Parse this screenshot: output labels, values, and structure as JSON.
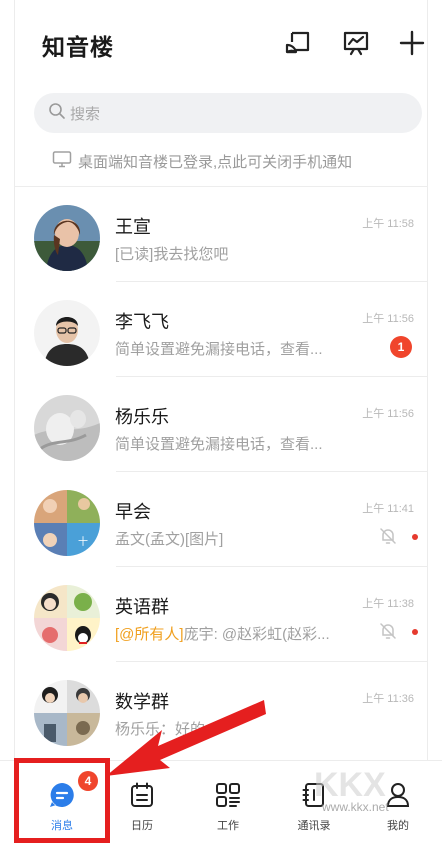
{
  "header": {
    "title": "知音楼",
    "icons": [
      "cast-icon",
      "presentation-icon",
      "plus-icon"
    ]
  },
  "search": {
    "placeholder": "搜索"
  },
  "notice": {
    "text": "桌面端知音楼已登录,点此可关闭手机通知"
  },
  "conversations": [
    {
      "name": "王宣",
      "preview": "[已读]我去找您吧",
      "time": "上午 11:58"
    },
    {
      "name": "李飞飞",
      "preview": "简单设置避免漏接电话，查看...",
      "time": "上午 11:56",
      "unread": "1"
    },
    {
      "name": "杨乐乐",
      "preview": "简单设置避免漏接电话，查看...",
      "time": "上午 11:56"
    },
    {
      "name": "早会",
      "preview": "孟文(孟文)[图片]",
      "time": "上午 11:41",
      "muted": true
    },
    {
      "name": "英语群",
      "mention": "[@所有人]",
      "preview": "庞宇: @赵彩虹(赵彩...",
      "time": "上午 11:38",
      "muted": true
    },
    {
      "name": "数学群",
      "preview": "杨乐乐：好的",
      "time": "上午 11:36"
    }
  ],
  "tabbar": {
    "tabs": [
      {
        "label": "消息",
        "badge": "4",
        "active": true
      },
      {
        "label": "日历"
      },
      {
        "label": "工作"
      },
      {
        "label": "通讯录"
      },
      {
        "label": "我的"
      }
    ]
  },
  "watermark": {
    "text": "www.kkx.net"
  },
  "colors": {
    "accent": "#2b7de9",
    "badge": "#f0452c",
    "highlight": "#e51f1f",
    "mention": "#f0a020"
  }
}
